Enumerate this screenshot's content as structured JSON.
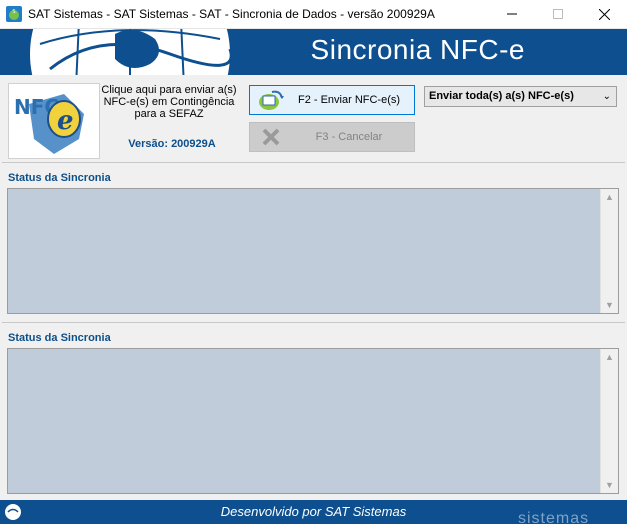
{
  "window": {
    "title": "SAT Sistemas - SAT Sistemas - SAT - Sincronia de Dados - versão 200929A",
    "icon": "app-icon",
    "controls": {
      "minimize": "─",
      "maximize": "☐",
      "close": "✕"
    }
  },
  "banner": {
    "title": "Sincronia NFC-e"
  },
  "logo": {
    "text": "NFC",
    "letter": "e"
  },
  "hint": {
    "text": "Clique aqui para enviar a(s) NFC-e(s) em Contingência para a SEFAZ"
  },
  "version": {
    "text": "Versão: 200929A"
  },
  "buttons": {
    "send": {
      "label": "F2 - Enviar NFC-e(s)",
      "icon": "send-nfce-icon"
    },
    "cancel": {
      "label": "F3 - Cancelar",
      "icon": "cancel-x-icon"
    }
  },
  "mode_select": {
    "value": "Enviar toda(s) a(s) NFC-e(s)",
    "caret": "⌄"
  },
  "sections": [
    {
      "label": "Status da Sincronia"
    },
    {
      "label": "Status da Sincronia"
    }
  ],
  "scroll": {
    "up": "▲",
    "down": "▼"
  },
  "footer": {
    "text": "Desenvolvido por SAT Sistemas",
    "brand": "sistemas"
  },
  "colors": {
    "brand_blue": "#0d4f8f",
    "label_blue": "#0e4f8a",
    "memo_bg": "#c0ccd9"
  }
}
